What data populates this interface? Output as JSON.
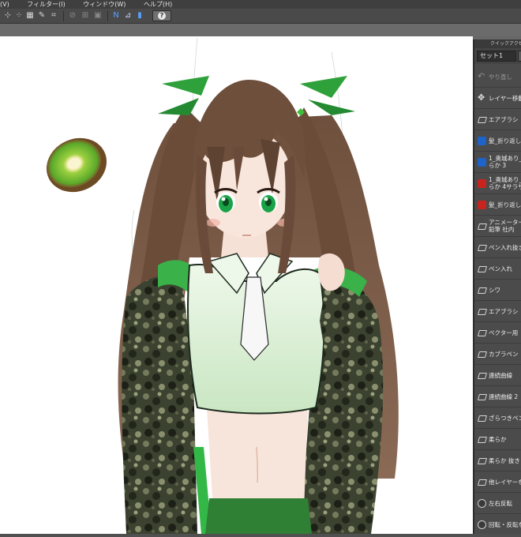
{
  "menu": {
    "items": [
      "(V)",
      "フィルター(I)",
      "ウィンドウ(W)",
      "ヘルプ(H)"
    ]
  },
  "toolbar": {
    "help_label": "?",
    "icons": [
      "transform-icon",
      "grid-icon",
      "pen-icon",
      "crop-icon",
      "ruler-icon",
      "snap-icon",
      "perspective-icon",
      "blue-ruler-icon",
      "curve-icon",
      "bucket-icon"
    ]
  },
  "quick_access": {
    "header": "クイックアクセス",
    "set_label": "セット1",
    "items": [
      {
        "label": "やり直し",
        "icon": "undo",
        "dim": true
      },
      {
        "label": "レイヤー移動",
        "icon": "move"
      },
      {
        "label": "エアブラシ",
        "icon": "plain"
      },
      {
        "label": "髪_折り返し",
        "icon": "blue"
      },
      {
        "label": "1_奥城あり_影\nらか 3",
        "icon": "blue"
      },
      {
        "label": "1_奥城あり_影\nらか 4サラサラ",
        "icon": "red"
      },
      {
        "label": "髪_折り返し",
        "icon": "red"
      },
      {
        "label": "アニメーター専用\n鉛筆 社内",
        "icon": "plain"
      },
      {
        "label": "ペン入れ抜き",
        "icon": "plain"
      },
      {
        "label": "ペン入れ",
        "icon": "plain"
      },
      {
        "label": "シワ",
        "icon": "plain"
      },
      {
        "label": "エアブラシ",
        "icon": "plain"
      },
      {
        "label": "ベクター用",
        "icon": "plain"
      },
      {
        "label": "カブラペン",
        "icon": "plain"
      },
      {
        "label": "連続曲線",
        "icon": "plain"
      },
      {
        "label": "連続曲線 2",
        "icon": "plain"
      },
      {
        "label": "ざらつきペン",
        "icon": "plain"
      },
      {
        "label": "柔らか",
        "icon": "plain"
      },
      {
        "label": "柔らか 抜き",
        "icon": "plain"
      },
      {
        "label": "他レイヤーを参照",
        "icon": "plain"
      },
      {
        "label": "左右反転",
        "icon": "circ"
      },
      {
        "label": "回転・反転を戻す",
        "icon": "circ"
      }
    ]
  },
  "colors": {
    "canvas": "#ffffff",
    "hair": "#7b5a44",
    "hair_dark": "#4e3526",
    "ribbon_green": "#2e9a3a",
    "eye_green": "#19a344",
    "camo_dark": "#2f3325",
    "shirt": "#e4f2df",
    "kiwi_green": "#6bbf2b"
  }
}
